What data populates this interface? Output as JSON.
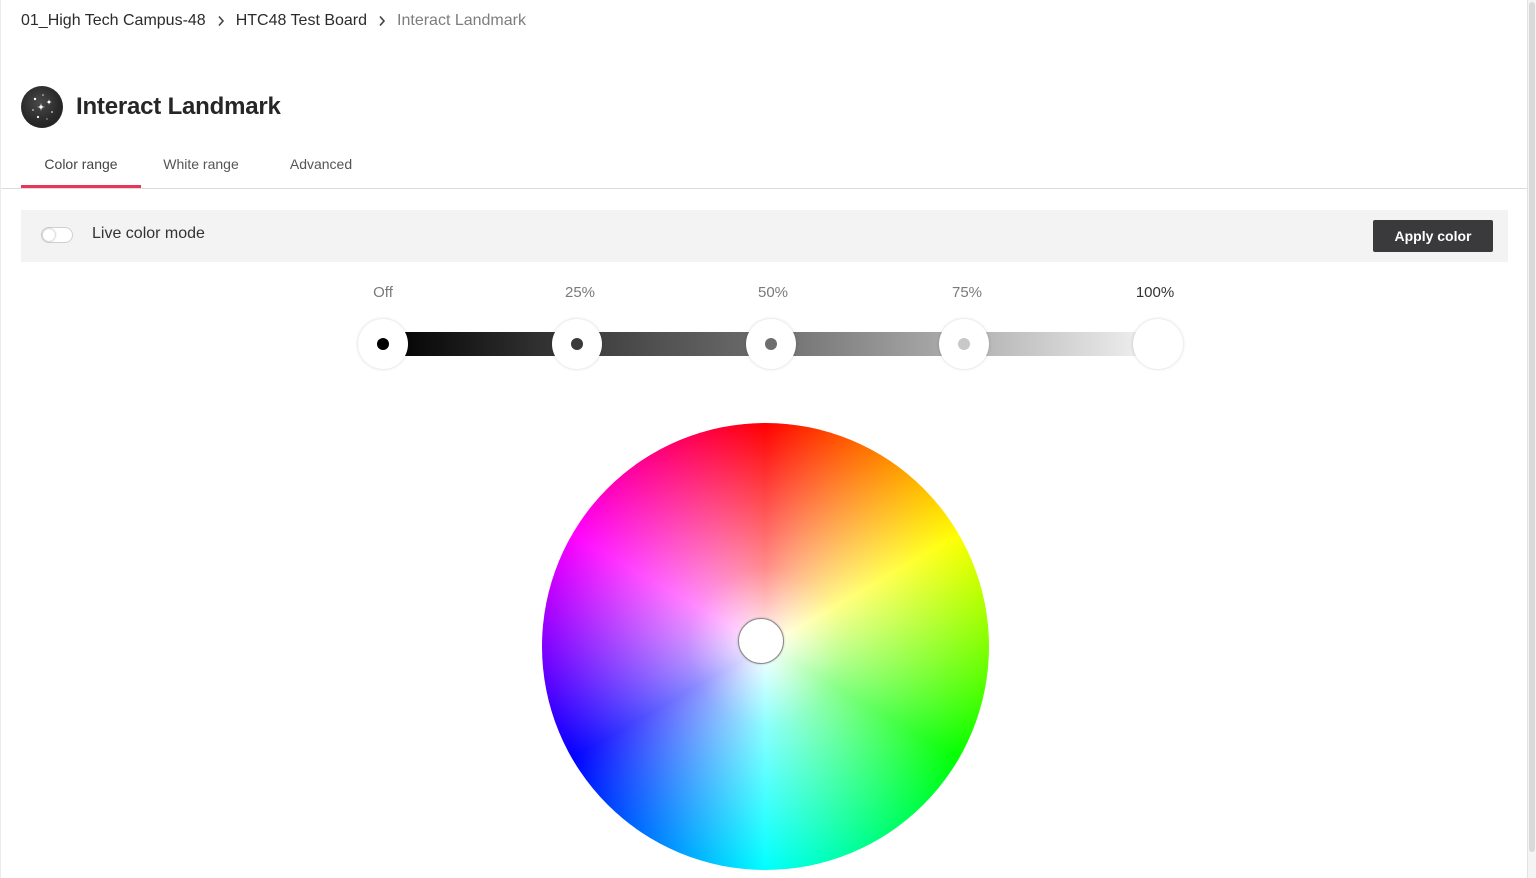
{
  "breadcrumb": {
    "items": [
      {
        "label": "01_High Tech Campus-48"
      },
      {
        "label": "HTC48 Test Board"
      },
      {
        "label": "Interact Landmark"
      }
    ]
  },
  "header": {
    "title": "Interact Landmark",
    "avatar_icon": "starry-sky-icon"
  },
  "tabs": [
    {
      "label": "Color range",
      "active": true
    },
    {
      "label": "White range",
      "active": false
    },
    {
      "label": "Advanced",
      "active": false
    }
  ],
  "live_mode": {
    "label": "Live color mode",
    "enabled": false
  },
  "apply_button": {
    "label": "Apply color"
  },
  "brightness": {
    "stops": [
      {
        "label": "Off",
        "dot_color": "#000000"
      },
      {
        "label": "25%",
        "dot_color": "#3a3a3a"
      },
      {
        "label": "50%",
        "dot_color": "#6e6e6e"
      },
      {
        "label": "75%",
        "dot_color": "#c8c8c8"
      },
      {
        "label": "100%",
        "dot_color": "#ffffff"
      }
    ]
  },
  "colors": {
    "accent": "#e8365a",
    "button_bg": "#3a3a3c"
  },
  "color_wheel": {
    "selected_saturation": 0,
    "selected_color": "#ffffff"
  }
}
